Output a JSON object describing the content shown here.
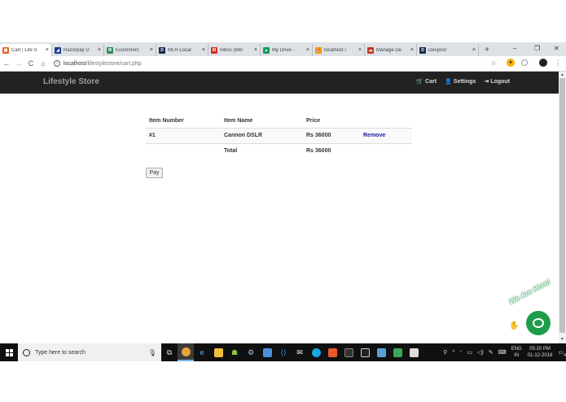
{
  "browser": {
    "tabs": [
      {
        "label": "Cart | Life S",
        "color": "#e8642a",
        "glyph": "▣",
        "active": true
      },
      {
        "label": "Razorpay D",
        "color": "#1b3b8f",
        "glyph": "◢",
        "active": false
      },
      {
        "label": "Ecommerc",
        "color": "#2e8b57",
        "glyph": "W",
        "active": false
      },
      {
        "label": "MLH Local",
        "color": "#1a2a4a",
        "glyph": "D",
        "active": false
      },
      {
        "label": "Inbox (840",
        "color": "#d93025",
        "glyph": "M",
        "active": false
      },
      {
        "label": "My Drive -",
        "color": "#0f9d58",
        "glyph": "▲",
        "active": false
      },
      {
        "label": "localhost /",
        "color": "#f29900",
        "glyph": "⛵",
        "active": false
      },
      {
        "label": "Manage De",
        "color": "#c0392b",
        "glyph": "☁",
        "active": false
      },
      {
        "label": "Devpost",
        "color": "#1a2a4a",
        "glyph": "D",
        "active": false
      }
    ],
    "tab_close": "×",
    "new_tab": "+",
    "window_controls": {
      "minimize": "–",
      "restore": "❐",
      "close": "✕"
    },
    "nav": {
      "back": "←",
      "forward": "→",
      "reload": "C",
      "home": "⌂"
    },
    "url_host": "localhost",
    "url_path": "/lifestylestore/cart.php",
    "info_icon": "i"
  },
  "site": {
    "brand": "Lifestyle Store",
    "nav": [
      {
        "label": "Cart",
        "icon": "🛒"
      },
      {
        "label": "Settings",
        "icon": "👤"
      },
      {
        "label": "Logout",
        "icon": "⇥"
      }
    ]
  },
  "cart": {
    "headers": [
      "Item Number",
      "Item Name",
      "Price",
      ""
    ],
    "items": [
      {
        "number": "#1",
        "name": "Cannon DSLR",
        "price": "Rs 36000",
        "action": "Remove"
      }
    ],
    "total_label": "Total",
    "total_value": "Rs 36000",
    "pay_label": "Pay"
  },
  "chat_widget": {
    "label": "We Are Here!",
    "color": "#1e9c4a"
  },
  "taskbar": {
    "search_placeholder": "Type here to search",
    "language_top": "ENG",
    "language_bottom": "IN",
    "time": "05:20 PM",
    "date": "01-12-2018",
    "notification_count": "4"
  }
}
